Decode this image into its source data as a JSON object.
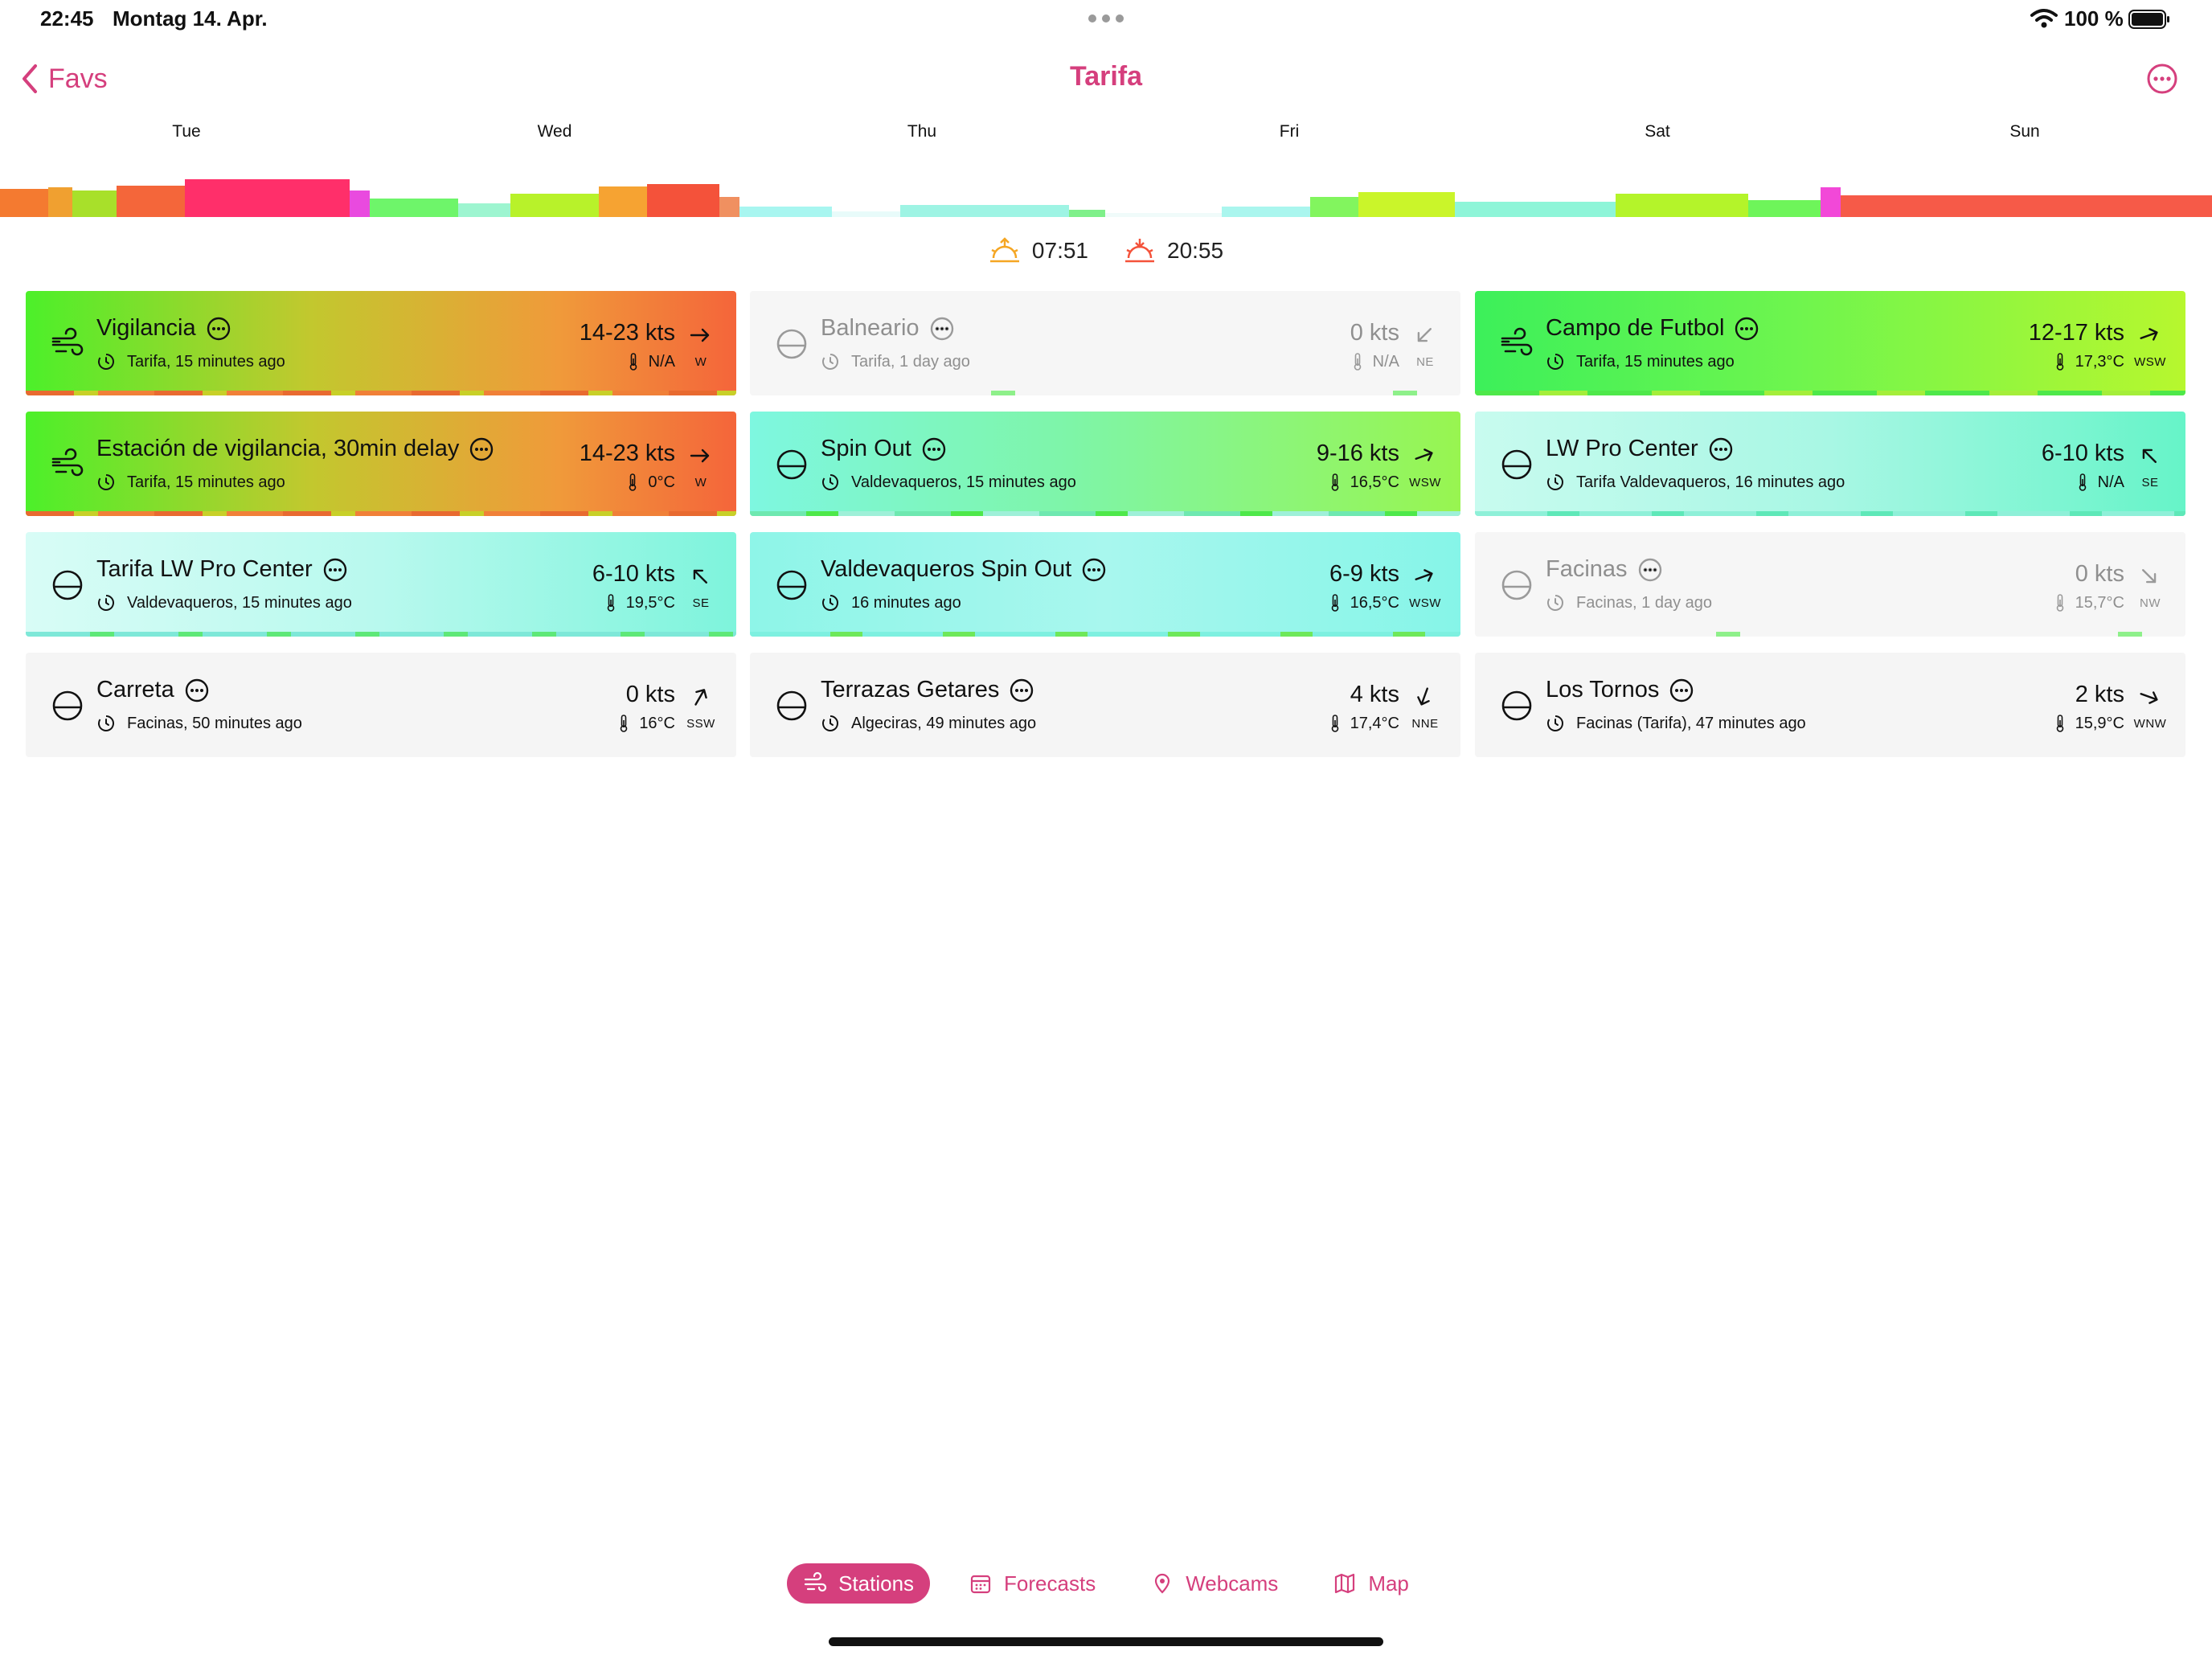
{
  "status_bar": {
    "time": "22:45",
    "date": "Montag 14. Apr.",
    "battery_pct": "100 %"
  },
  "nav": {
    "back_label": "Favs",
    "title": "Tarifa"
  },
  "days": [
    "Tue",
    "Wed",
    "Thu",
    "Fri",
    "Sat",
    "Sun"
  ],
  "sun": {
    "sunrise": "07:51",
    "sunset": "20:55"
  },
  "stations": [
    {
      "name": "Vigilancia",
      "location": "Tarifa, 15 minutes ago",
      "speed": "14-23 kts",
      "temp": "N/A",
      "dir": "W",
      "icon": "wind-icon",
      "style": "hot"
    },
    {
      "name": "Balneario",
      "location": "Tarifa, 1 day ago",
      "speed": "0 kts",
      "temp": "N/A",
      "dir": "NE",
      "icon": "calm-icon",
      "style": "dim"
    },
    {
      "name": "Campo de Futbol",
      "location": "Tarifa, 15 minutes ago",
      "speed": "12-17 kts",
      "temp": "17,3°C",
      "dir": "WSW",
      "icon": "wind-icon",
      "style": "green"
    },
    {
      "name": "Estación de vigilancia, 30min delay",
      "location": "Tarifa, 15 minutes ago",
      "speed": "14-23 kts",
      "temp": "0°C",
      "dir": "W",
      "icon": "wind-icon",
      "style": "hot"
    },
    {
      "name": "Spin Out",
      "location": "Valdevaqueros, 15 minutes ago",
      "speed": "9-16 kts",
      "temp": "16,5°C",
      "dir": "WSW",
      "icon": "calm-icon",
      "style": "teal-green"
    },
    {
      "name": "LW Pro Center",
      "location": "Tarifa Valdevaqueros, 16 minutes ago",
      "speed": "6-10 kts",
      "temp": "N/A",
      "dir": "SE",
      "icon": "calm-icon",
      "style": "light-teal"
    },
    {
      "name": "Tarifa LW Pro Center",
      "location": "Valdevaqueros, 15 minutes ago",
      "speed": "6-10 kts",
      "temp": "19,5°C",
      "dir": "SE",
      "icon": "calm-icon",
      "style": "light-teal-2"
    },
    {
      "name": "Valdevaqueros Spin Out",
      "location": "16 minutes ago",
      "speed": "6-9 kts",
      "temp": "16,5°C",
      "dir": "WSW",
      "icon": "calm-icon",
      "style": "teal"
    },
    {
      "name": "Facinas",
      "location": "Facinas, 1 day ago",
      "speed": "0 kts",
      "temp": "15,7°C",
      "dir": "NW",
      "icon": "calm-icon",
      "style": "dim"
    },
    {
      "name": "Carreta",
      "location": "Facinas, 50 minutes ago",
      "speed": "0 kts",
      "temp": "16°C",
      "dir": "SSW",
      "icon": "calm-icon",
      "style": "plain"
    },
    {
      "name": "Terrazas Getares",
      "location": "Algeciras, 49 minutes ago",
      "speed": "4 kts",
      "temp": "17,4°C",
      "dir": "NNE",
      "icon": "calm-icon",
      "style": "plain"
    },
    {
      "name": "Los Tornos",
      "location": "Facinas (Tarifa), 47 minutes ago",
      "speed": "2 kts",
      "temp": "15,9°C",
      "dir": "WNW",
      "icon": "calm-icon",
      "style": "plain"
    }
  ],
  "tabs": [
    {
      "label": "Stations",
      "icon": "wind-icon",
      "active": true
    },
    {
      "label": "Forecasts",
      "icon": "calendar-icon",
      "active": false
    },
    {
      "label": "Webcams",
      "icon": "pin-icon",
      "active": false
    },
    {
      "label": "Map",
      "icon": "map-icon",
      "active": false
    }
  ],
  "colors": {
    "accent": "#d53f7d",
    "hot_gradient": [
      "#4cf02a",
      "#f46538"
    ],
    "green_gradient": [
      "#3cf05a",
      "#b7f72e"
    ],
    "teal_green_gradient": [
      "#7ef7e0",
      "#98f550"
    ],
    "light_teal_gradient": [
      "#c8fbef",
      "#66f4c8"
    ],
    "teal_gradient": [
      "#8ef5e8",
      "#86f5e8"
    ]
  }
}
